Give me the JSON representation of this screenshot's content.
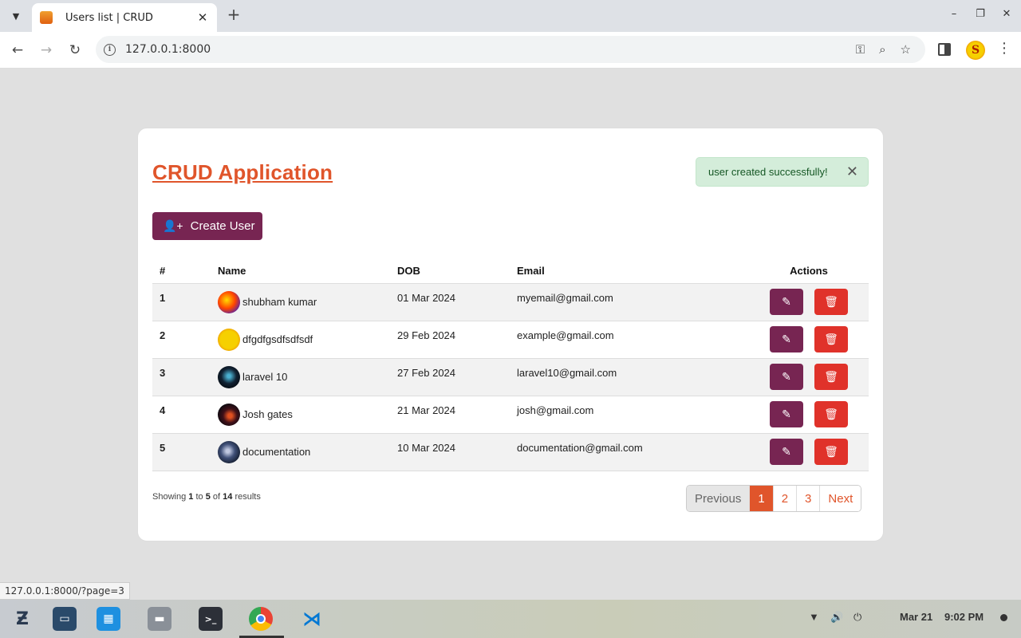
{
  "browser": {
    "tab_title": "Users list | CRUD",
    "url": "127.0.0.1:8000",
    "profile_initial": "S",
    "status_url": "127.0.0.1:8000/?page=3"
  },
  "app": {
    "title": "CRUD Application",
    "alert": "user created successfully!",
    "create_button": "Create User"
  },
  "table": {
    "headers": [
      "#",
      "Name",
      "DOB",
      "Email",
      "Actions"
    ],
    "rows": [
      {
        "num": "1",
        "name": "shubham kumar",
        "dob": "01 Mar 2024",
        "email": "myemail@gmail.com"
      },
      {
        "num": "2",
        "name": "dfgdfgsdfsdfsdf",
        "dob": "29 Feb 2024",
        "email": "example@gmail.com"
      },
      {
        "num": "3",
        "name": "laravel 10",
        "dob": "27 Feb 2024",
        "email": "laravel10@gmail.com"
      },
      {
        "num": "4",
        "name": "Josh gates",
        "dob": "21 Mar 2024",
        "email": "josh@gmail.com"
      },
      {
        "num": "5",
        "name": "documentation",
        "dob": "10 Mar 2024",
        "email": "documentation@gmail.com"
      }
    ]
  },
  "pagination": {
    "showing_prefix": "Showing",
    "from": "1",
    "to_word": "to",
    "to": "5",
    "of_word": "of",
    "total": "14",
    "results_word": "results",
    "previous": "Previous",
    "pages": [
      "1",
      "2",
      "3"
    ],
    "next": "Next"
  },
  "taskbar": {
    "date": "Mar 21",
    "time": "9:02 PM"
  },
  "colors": {
    "accent": "#e0552b",
    "primary_button": "#772552",
    "delete_button": "#e0322a",
    "alert_bg": "#d4edda"
  }
}
